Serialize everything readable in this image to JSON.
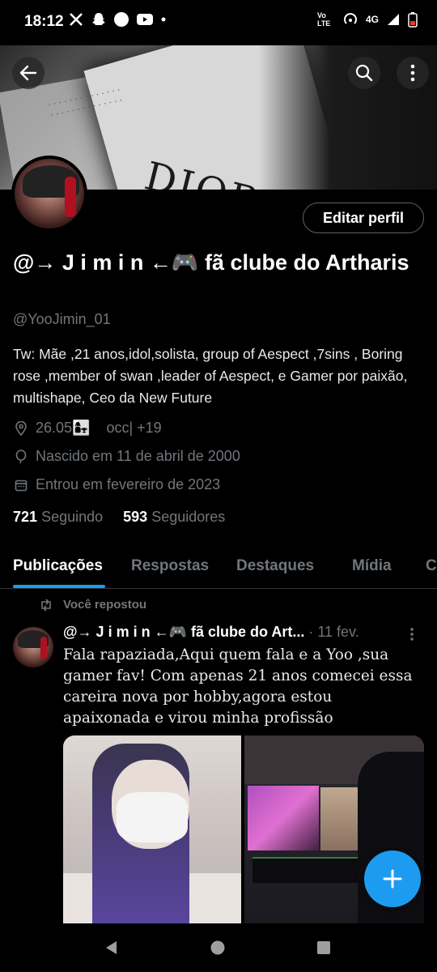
{
  "status_bar": {
    "time": "18:12",
    "network_label": "4G",
    "volte_label": "Vo LTE"
  },
  "banner": {
    "brand_text": "DIOR"
  },
  "profile": {
    "edit_button": "Editar perfil",
    "display_name": "@→ J i m i n ←🎮 fã clube do Artharis",
    "handle": "@YooJimin_01",
    "bio": "Tw: Mãe ,21 anos,idol,solista, group of Aespect ,7sins , Boring rose ,member of swan ,leader of Aespect,  e Gamer por paixão, multishape,  Ceo da New Future",
    "location": "26.05👩‍👧    occ| +19",
    "birth": "Nascido em 11 de abril de 2000",
    "joined": "Entrou em fevereiro de 2023",
    "following_count": "721",
    "following_label": "Seguindo",
    "followers_count": "593",
    "followers_label": "Seguidores"
  },
  "tabs": [
    {
      "label": "Publicações",
      "active": true
    },
    {
      "label": "Respostas"
    },
    {
      "label": "Destaques"
    },
    {
      "label": "Mídia"
    },
    {
      "label": "C"
    }
  ],
  "post": {
    "repost_label": "Você repostou",
    "author": "@→ J i m i n ←🎮 fã clube do Art...",
    "separator": "·",
    "date": "11 fev.",
    "text": "Fala rapaziada,Aqui quem fala e a Yoo ,sua gamer fav! Com apenas 21 anos comecei essa careira nova por hobby,agora estou apaixonada e virou minha profissão"
  },
  "colors": {
    "accent": "#1d9bf0",
    "background": "#000000",
    "muted": "#71767b"
  },
  "icons": [
    "back-arrow-icon",
    "search-icon",
    "more-vertical-icon",
    "location-icon",
    "balloon-icon",
    "calendar-icon",
    "repost-icon",
    "compose-plus-icon",
    "nav-back-icon",
    "nav-home-icon",
    "nav-recents-icon"
  ]
}
